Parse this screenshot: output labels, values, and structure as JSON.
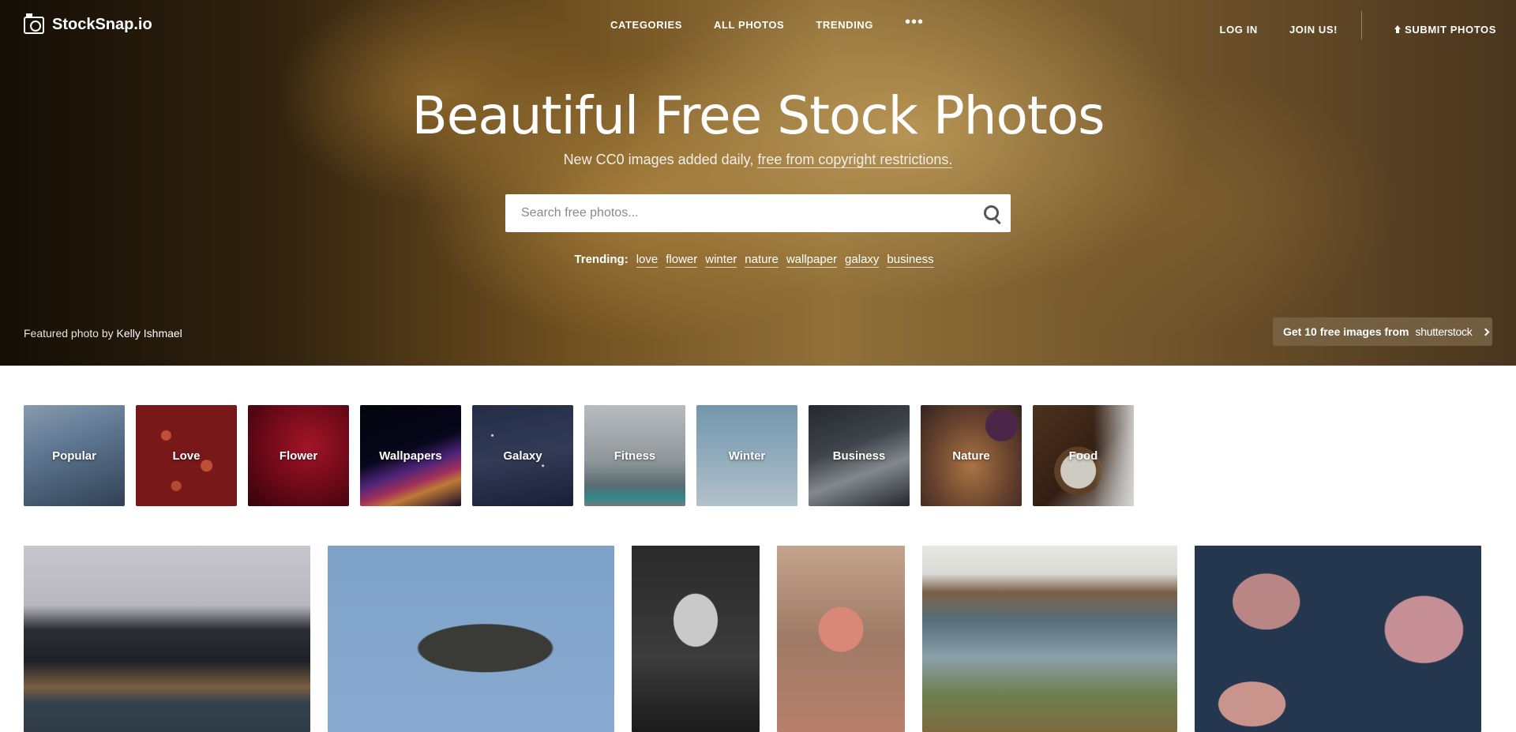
{
  "brand": {
    "name": "StockSnap.io"
  },
  "nav": {
    "center": [
      "CATEGORIES",
      "ALL PHOTOS",
      "TRENDING"
    ],
    "login": "LOG IN",
    "join": "JOIN US!",
    "submit": "SUBMIT PHOTOS"
  },
  "hero": {
    "title": "Beautiful Free Stock Photos",
    "subtitle_prefix": "New CC0 images added daily, ",
    "subtitle_link": "free from copyright restrictions.",
    "search_placeholder": "Search free photos...",
    "trending_label": "Trending:",
    "trending_tags": [
      "love",
      "flower",
      "winter",
      "nature",
      "wallpaper",
      "galaxy",
      "business"
    ],
    "featured_prefix": "Featured photo by",
    "featured_author": "Kelly Ishmael",
    "shutterstock_cta": "Get 10 free images from",
    "shutterstock_brand": "shutterstock"
  },
  "categories": [
    "Popular",
    "Love",
    "Flower",
    "Wallpapers",
    "Galaxy",
    "Fitness",
    "Winter",
    "Business",
    "Nature",
    "Food"
  ],
  "icons": {
    "logo": "camera-icon",
    "more": "more-dots-icon",
    "submit": "upload-icon",
    "search": "search-icon",
    "cta": "chevron-right-icon"
  }
}
